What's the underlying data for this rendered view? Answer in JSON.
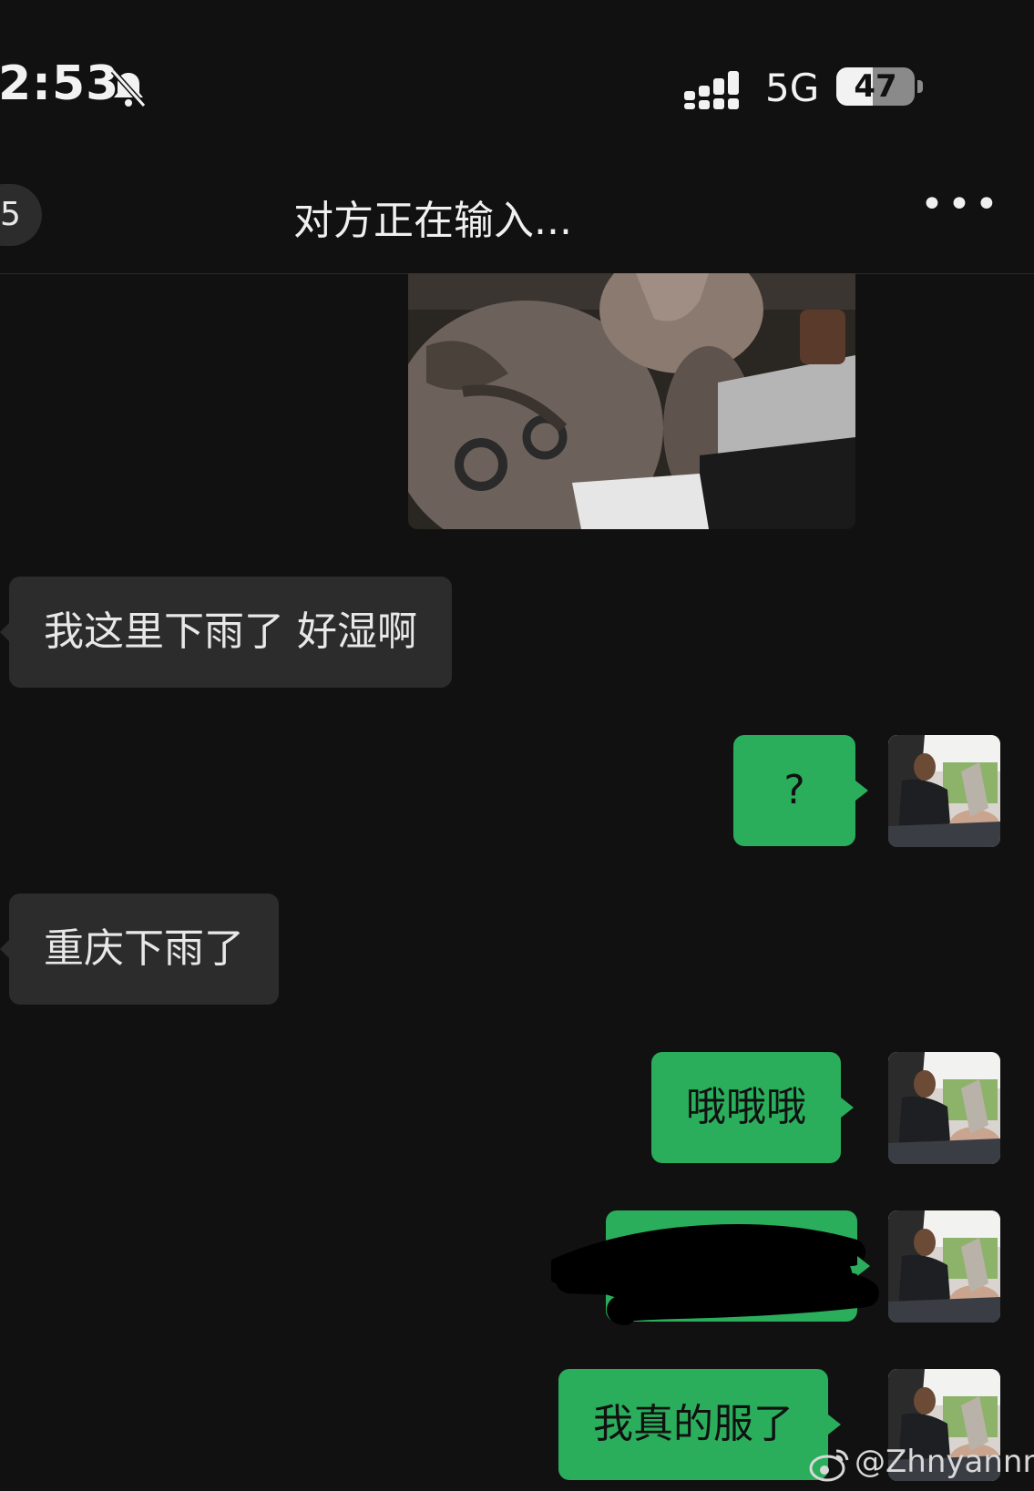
{
  "status_bar": {
    "time": "2:53",
    "network": "5G",
    "battery": "47",
    "battery_level": 0.47,
    "icons": [
      "bell-slash-icon",
      "signal-icon"
    ]
  },
  "nav": {
    "back_count": "5",
    "title": "对方正在输入...",
    "more_label": "•••"
  },
  "messages": [
    {
      "type": "image",
      "side": "received"
    },
    {
      "type": "text",
      "side": "received",
      "text": "我这里下雨了 好湿啊"
    },
    {
      "type": "text",
      "side": "sent",
      "text": "?"
    },
    {
      "type": "text",
      "side": "received",
      "text": "重庆下雨了"
    },
    {
      "type": "text",
      "side": "sent",
      "text": "哦哦哦"
    },
    {
      "type": "redacted",
      "side": "sent"
    },
    {
      "type": "text",
      "side": "sent",
      "text": "我真的服了"
    }
  ],
  "colors": {
    "background": "#111111",
    "sent_bubble": "#2aae5c",
    "received_bubble": "#2c2c2c"
  },
  "watermark": "@Zhnyannn_"
}
